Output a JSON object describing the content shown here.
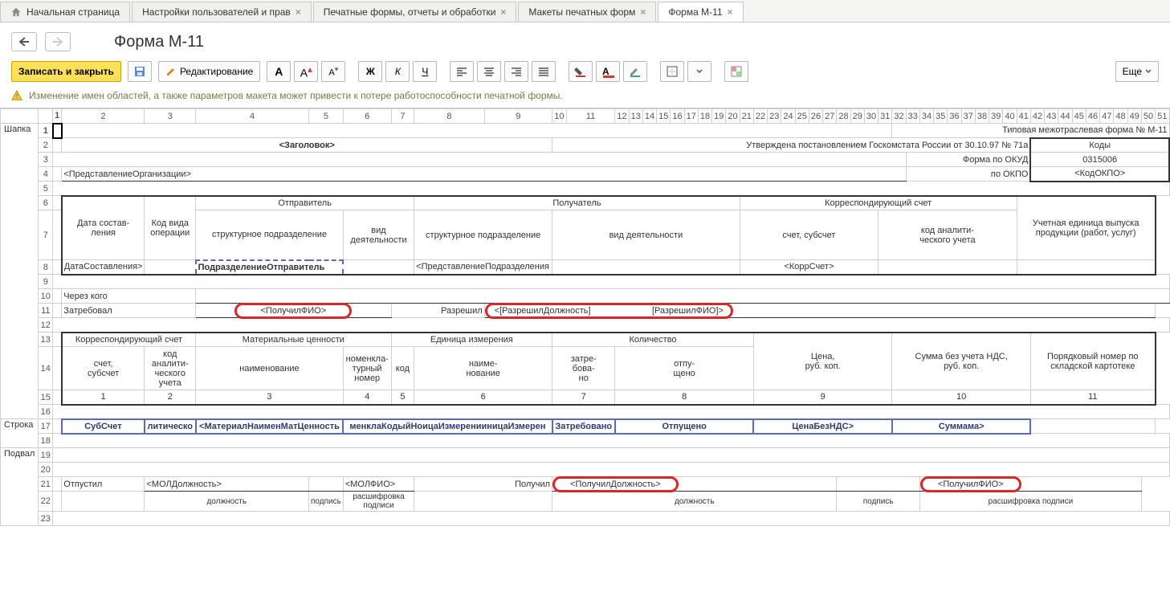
{
  "tabs": [
    {
      "label": "Начальная страница",
      "closable": false,
      "home": true
    },
    {
      "label": "Настройки пользователей и прав",
      "closable": true
    },
    {
      "label": "Печатные формы, отчеты и обработки",
      "closable": true
    },
    {
      "label": "Макеты печатных форм",
      "closable": true
    },
    {
      "label": "Форма М-11",
      "closable": true,
      "active": true
    }
  ],
  "page_title": "Форма М-11",
  "toolbar": {
    "save_close": "Записать и закрыть",
    "edit": "Редактирование",
    "more": "Еще"
  },
  "warning": "Изменение имен областей, а также параметров макета может привести к потере работоспособности печатной формы.",
  "col_headers": [
    "1",
    "2",
    "3",
    "4",
    "5",
    "6",
    "7",
    "8",
    "9",
    "10",
    "11",
    "12",
    "13",
    "14",
    "15",
    "16",
    "17",
    "18",
    "19",
    "20",
    "21",
    "22",
    "23",
    "24",
    "25",
    "26",
    "27",
    "28",
    "29",
    "30",
    "31",
    "32",
    "33",
    "34",
    "35",
    "36",
    "37",
    "38",
    "39",
    "40",
    "41",
    "42",
    "43",
    "44",
    "45",
    "46",
    "47",
    "48",
    "49",
    "50",
    "51"
  ],
  "sections": {
    "r1": "Шапка",
    "r17": "Строка",
    "r19": "Подвал"
  },
  "rows": {
    "r1": {
      "top_right1": "Типовая межотраслевая форма № М-11"
    },
    "r2": {
      "title": "<Заголовок>",
      "top_right2": "Утверждена постановлением Госкомстата России от 30.10.97 № 71а",
      "codes": "Коды"
    },
    "r3": {
      "okud_label": "Форма по ОКУД",
      "okud_val": "0315006"
    },
    "r4": {
      "org": "<ПредставлениеОрганизации>",
      "okpo_label": "по ОКПО",
      "okpo_val": "<КодОКПО>"
    },
    "r6": {
      "sender": "Отправитель",
      "receiver": "Получатель",
      "corr": "Корреспондирующий счет",
      "unit": "Учетная единица выпуска продукции (работ, услуг)"
    },
    "r7": {
      "date": "Дата состав-\nления",
      "opkind": "Код вида операции",
      "struct": "структурное подразделение",
      "act": "вид деятельности",
      "acct": "счет, субсчет",
      "anal": "код аналити-\nческого учета"
    },
    "r8": {
      "date": "ДатаСоставления>",
      "dept": "ПодразделениеОтправитель",
      "recv": "<ПредставлениеПодразделения",
      "corr": "<КоррСчет>"
    },
    "r10": {
      "through": "Через кого"
    },
    "r11": {
      "req": "Затребовал",
      "req_v": "<ПолучилФИО>",
      "perm": "Разрешил",
      "perm_v": "<[РазрешилДолжность]                         [РазрешилФИО]>"
    },
    "r13": {
      "corr": "Корреспондирующий счет",
      "mat": "Материальные ценности",
      "unit": "Единица измерения",
      "qty": "Количество",
      "price": "Цена,\nруб. коп.",
      "sum": "Сумма без учета НДС,\nруб. коп.",
      "ord": "Порядковый номер по складской картотеке"
    },
    "r14": {
      "acct": "счет,\nсубсчет",
      "anal": "код аналити-\nческого учета",
      "name": "наименование",
      "nomen": "номенкла-\nтурный номер",
      "code": "код",
      "uname": "наиме-\nнование",
      "reqd": "затре-\nбова-\nно",
      "rel": "отпу-\nщено"
    },
    "r15": {
      "c1": "1",
      "c2": "2",
      "c3": "3",
      "c4": "4",
      "c5": "5",
      "c6": "6",
      "c7": "7",
      "c8": "8",
      "c9": "9",
      "c10": "10",
      "c11": "11"
    },
    "r17": {
      "c1": "СубСчет",
      "c2": "литическо",
      "c3": "<МатериалНаименМатЦенность",
      "c4": "менклаКодыйНоицаИзмеренииницаИзмерен",
      "c7": "Затребовано",
      "c8": "Отпущено",
      "c9": "ЦенаБезНДС>",
      "c10": "Суммама>"
    },
    "r21": {
      "rel": "Отпустил",
      "pos": "<МОЛДолжность>",
      "fio": "<МОЛФИО>",
      "got": "Получил",
      "gpos": "<ПолучилДолжность>",
      "gfio": "<ПолучилФИО>"
    },
    "r22": {
      "pos": "должность",
      "sign": "подпись",
      "dec": "расшифровка подписи"
    }
  }
}
